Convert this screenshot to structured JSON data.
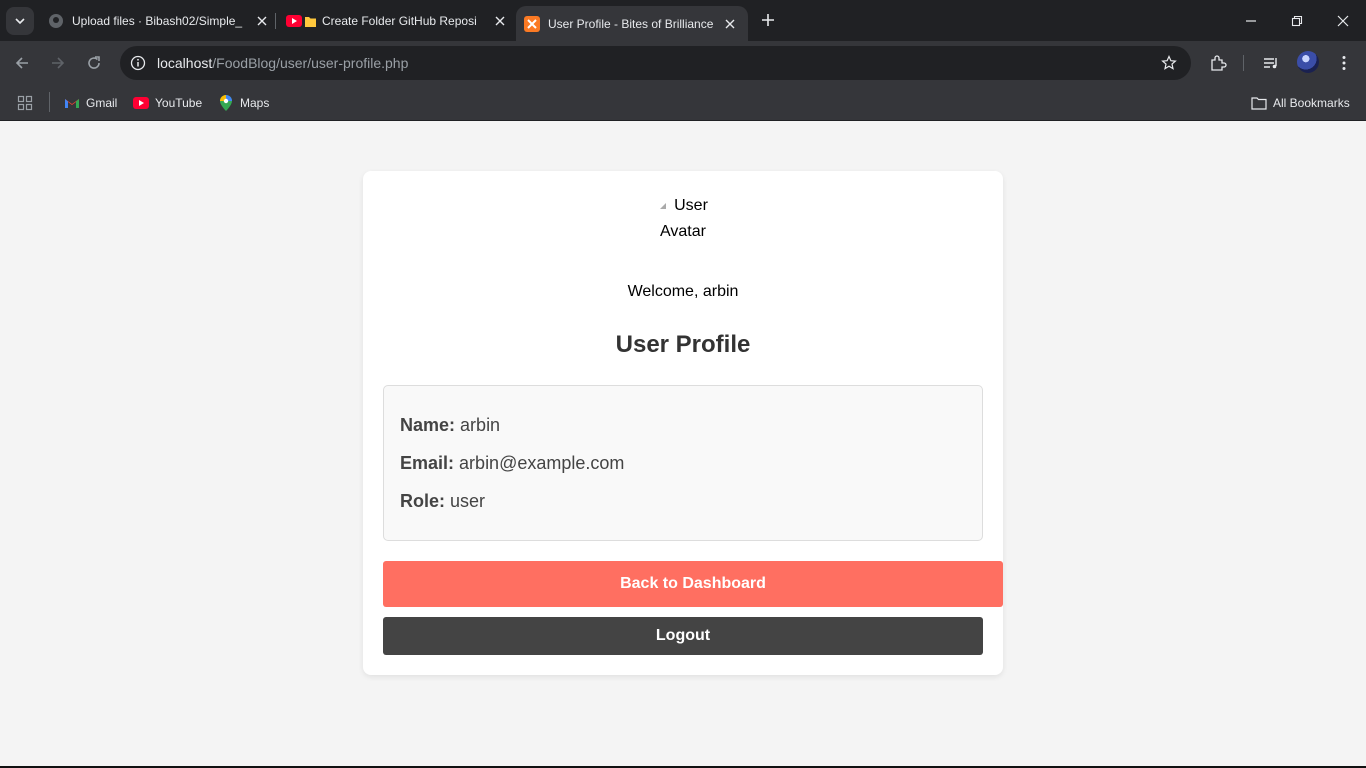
{
  "browser": {
    "tabs": [
      {
        "title": "Upload files · Bibash02/Simple_",
        "favicon": "github-icon",
        "active": false
      },
      {
        "title": "Create Folder GitHub Reposi",
        "favicon": "youtube-folder-icon",
        "active": false
      },
      {
        "title": "User Profile - Bites of Brilliance",
        "favicon": "xampp-icon",
        "active": true
      }
    ],
    "url": {
      "host": "localhost",
      "path": "/FoodBlog/user/user-profile.php"
    },
    "bookmarks": [
      {
        "label": "Gmail",
        "icon": "gmail-icon"
      },
      {
        "label": "YouTube",
        "icon": "youtube-icon"
      },
      {
        "label": "Maps",
        "icon": "maps-icon"
      }
    ],
    "all_bookmarks_label": "All Bookmarks"
  },
  "page": {
    "avatar_alt_line1": "User",
    "avatar_alt_line2": "Avatar",
    "welcome": "Welcome, arbin",
    "title": "User Profile",
    "profile": {
      "name_label": "Name:",
      "name_value": "arbin",
      "email_label": "Email:",
      "email_value": "arbin@example.com",
      "role_label": "Role:",
      "role_value": "user"
    },
    "dashboard_button": "Back to Dashboard",
    "logout_button": "Logout"
  },
  "colors": {
    "page_bg": "#f4f4f4",
    "card_bg": "#ffffff",
    "dashboard_button": "#ff6f61",
    "logout_button": "#444444",
    "browser_dark": "#202124",
    "browser_toolbar": "#35363a"
  }
}
